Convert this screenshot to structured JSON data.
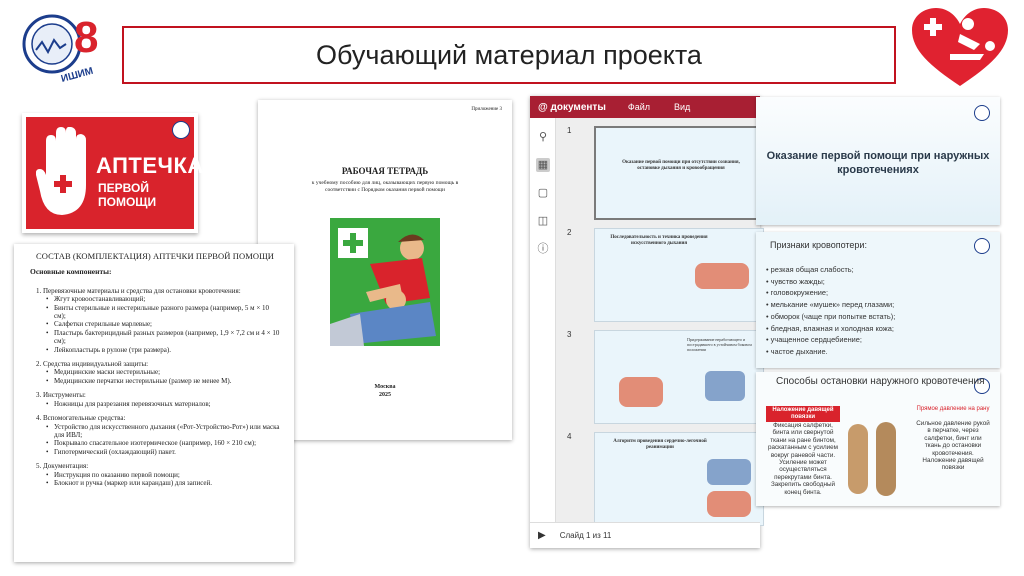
{
  "header": {
    "title": "Обучающий материал проекта",
    "logo_caption": "ИШИМ",
    "logo_number": "8"
  },
  "aptechka": {
    "line1": "АПТЕЧКА",
    "line2": "ПЕРВОЙ ПОМОЩИ"
  },
  "workbook": {
    "appendix": "Приложение 3",
    "title": "РАБОЧАЯ ТЕТРАДЬ",
    "subtitle": "к учебному пособию для лиц, оказывающих первую помощь в соответствии с Порядком оказания первой помощи",
    "city": "Москва",
    "year": "2025"
  },
  "composition": {
    "title": "СОСТАВ (КОМПЛЕКТАЦИЯ) АПТЕЧКИ ПЕРВОЙ ПОМОЩИ",
    "subtitle": "Основные компоненты:",
    "sections": [
      {
        "head": "1.  Перевязочные материалы и средства для остановки кровотечения:",
        "items": [
          "Жгут кровоостанавливающий;",
          "Бинты стерильные и нестерильные разного размера (например, 5 м × 10 см);",
          "Салфетки стерильные марлевые;",
          "Пластырь бактерицидный разных размеров (например, 1,9 × 7,2 см и 4 × 10 см);",
          "Лейкопластырь в рулоне (три размера)."
        ]
      },
      {
        "head": "2.  Средства индивидуальной защиты:",
        "items": [
          "Медицинские маски нестерильные;",
          "Медицинские перчатки нестерильные (размер не менее М)."
        ]
      },
      {
        "head": "3.  Инструменты:",
        "items": [
          "Ножницы для разрезания перевязочных материалов;"
        ]
      },
      {
        "head": "4.  Вспомогательные средства:",
        "items": [
          "Устройство для искусственного дыхания («Рот-Устройство-Рот») или маска для ИВЛ;",
          "Покрывало спасательное изотермическое (например, 160 × 210 см);",
          "Гипотермический (охлаждающий) пакет."
        ]
      },
      {
        "head": "5.  Документация:",
        "items": [
          "Инструкция по оказанию первой помощи;",
          "Блокнот и ручка (маркер или карандаш) для записей."
        ]
      }
    ]
  },
  "viewer": {
    "app_name": "@ документы",
    "menu": [
      "Файл",
      "Вид"
    ],
    "slide_numbers": [
      "1",
      "2",
      "3",
      "4"
    ],
    "slide1_title": "Оказание первой помощи при отсутствии сознания, остановке дыхания и кровообращения",
    "slide2_title": "Последовательность и техника проведения искусственного дыхания",
    "slide3_text": "Придерживание неработающего и пострадавшего в устойчивом боковом положении",
    "slide4_title": "Алгоритм проведения сердечно-легочной реанимации",
    "status": "Слайд 1 из 11"
  },
  "right_slides": {
    "s1_title": "Оказание первой помощи при наружных кровотечениях",
    "s2_title": "Признаки кровопотери:",
    "s2_items": [
      "резкая общая слабость;",
      "чувство жажды;",
      "головокружение;",
      "мелькание «мушек» перед глазами;",
      "обморок (чаще при попытке встать);",
      "бледная, влажная и холодная кожа;",
      "учащенное сердцебиение;",
      "частое дыхание."
    ],
    "s3_title": "Способы остановки наружного кровотечения",
    "s3_h1": "Наложение давящей повязки",
    "s3_b1": "Фиксация салфетки, бинта или свернутой ткани на ране бинтом, раскатанным с усилием вокруг раневой части. Усиление может осуществляться перекрутами бинта. Закрепить свободный конец бинта.",
    "s3_h2": "Прямое давление на рану",
    "s3_b2": "Сильное давление рукой в перчатке, через салфетки, бинт или ткань до остановки кровотечения. Наложение давящей повязки"
  }
}
